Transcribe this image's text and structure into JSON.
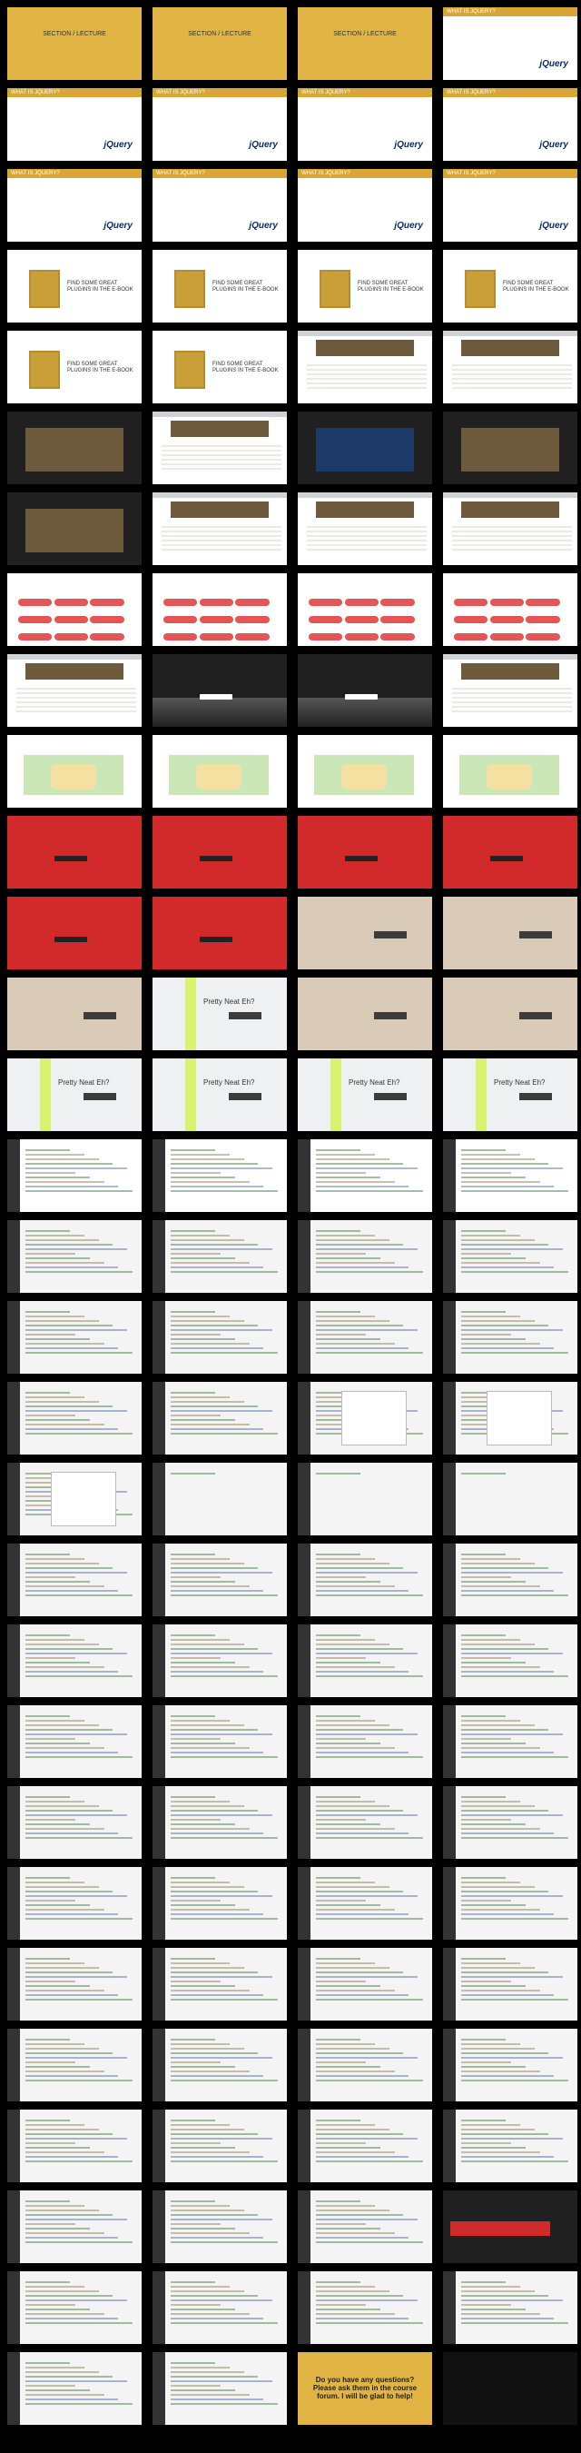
{
  "slide_texts": {
    "what_is_jquery": "WHAT IS JQUERY?",
    "section_label": "SECTION",
    "lecture_label": "LECTURE",
    "jquery_logo": "jQuery",
    "find_plugins": "FIND SOME GREAT PLUGINS IN THE E-BOOK",
    "pretty_neat": "Pretty Neat Eh?",
    "final_question": "Do you have any questions? Please ask them in the course forum. I will be glad to help!"
  },
  "rows": [
    {
      "cells": [
        {
          "type": "gold-section"
        },
        {
          "type": "gold-section"
        },
        {
          "type": "gold-section"
        },
        {
          "type": "white-header"
        }
      ]
    },
    {
      "cells": [
        {
          "type": "white-header"
        },
        {
          "type": "white-header"
        },
        {
          "type": "white-header"
        },
        {
          "type": "white-header"
        }
      ]
    },
    {
      "cells": [
        {
          "type": "white-header"
        },
        {
          "type": "white-header"
        },
        {
          "type": "white-header"
        },
        {
          "type": "white-header"
        }
      ]
    },
    {
      "cells": [
        {
          "type": "white-book"
        },
        {
          "type": "white-book"
        },
        {
          "type": "white-book"
        },
        {
          "type": "white-book"
        }
      ]
    },
    {
      "cells": [
        {
          "type": "white-book"
        },
        {
          "type": "white-book"
        },
        {
          "type": "browser-article"
        },
        {
          "type": "browser-article"
        }
      ]
    },
    {
      "cells": [
        {
          "type": "dark-image"
        },
        {
          "type": "browser-article"
        },
        {
          "type": "dark-image-blue"
        },
        {
          "type": "dark-image"
        }
      ]
    },
    {
      "cells": [
        {
          "type": "dark-image"
        },
        {
          "type": "browser-article"
        },
        {
          "type": "browser-article"
        },
        {
          "type": "browser-article"
        }
      ]
    },
    {
      "cells": [
        {
          "type": "tiles"
        },
        {
          "type": "tiles"
        },
        {
          "type": "tiles"
        },
        {
          "type": "tiles"
        }
      ]
    },
    {
      "cells": [
        {
          "type": "browser-article"
        },
        {
          "type": "mountains"
        },
        {
          "type": "mountains"
        },
        {
          "type": "browser-article"
        }
      ]
    },
    {
      "cells": [
        {
          "type": "map"
        },
        {
          "type": "map"
        },
        {
          "type": "map"
        },
        {
          "type": "map"
        }
      ]
    },
    {
      "cells": [
        {
          "type": "red"
        },
        {
          "type": "red"
        },
        {
          "type": "red"
        },
        {
          "type": "red"
        }
      ]
    },
    {
      "cells": [
        {
          "type": "red"
        },
        {
          "type": "red"
        },
        {
          "type": "beige"
        },
        {
          "type": "beige"
        }
      ]
    },
    {
      "cells": [
        {
          "type": "beige"
        },
        {
          "type": "yellow"
        },
        {
          "type": "beige"
        },
        {
          "type": "beige"
        }
      ]
    },
    {
      "cells": [
        {
          "type": "yellow"
        },
        {
          "type": "yellow"
        },
        {
          "type": "yellow"
        },
        {
          "type": "yellow"
        }
      ]
    },
    {
      "cells": [
        {
          "type": "code-doc"
        },
        {
          "type": "code-doc"
        },
        {
          "type": "code-doc"
        },
        {
          "type": "code-doc"
        }
      ]
    },
    {
      "cells": [
        {
          "type": "code"
        },
        {
          "type": "code"
        },
        {
          "type": "code"
        },
        {
          "type": "code"
        }
      ]
    },
    {
      "cells": [
        {
          "type": "code"
        },
        {
          "type": "code"
        },
        {
          "type": "code"
        },
        {
          "type": "code"
        }
      ]
    },
    {
      "cells": [
        {
          "type": "code"
        },
        {
          "type": "code"
        },
        {
          "type": "code-modal"
        },
        {
          "type": "code-modal"
        }
      ]
    },
    {
      "cells": [
        {
          "type": "code-modal"
        },
        {
          "type": "code-blank"
        },
        {
          "type": "code-blank"
        },
        {
          "type": "code-blank"
        }
      ]
    },
    {
      "cells": [
        {
          "type": "code"
        },
        {
          "type": "code"
        },
        {
          "type": "code"
        },
        {
          "type": "code"
        }
      ]
    },
    {
      "cells": [
        {
          "type": "code"
        },
        {
          "type": "code"
        },
        {
          "type": "code"
        },
        {
          "type": "code"
        }
      ]
    },
    {
      "cells": [
        {
          "type": "code"
        },
        {
          "type": "code"
        },
        {
          "type": "code"
        },
        {
          "type": "code"
        }
      ]
    },
    {
      "cells": [
        {
          "type": "code"
        },
        {
          "type": "code"
        },
        {
          "type": "code"
        },
        {
          "type": "code"
        }
      ]
    },
    {
      "cells": [
        {
          "type": "code"
        },
        {
          "type": "code"
        },
        {
          "type": "code"
        },
        {
          "type": "code"
        }
      ]
    },
    {
      "cells": [
        {
          "type": "code"
        },
        {
          "type": "code"
        },
        {
          "type": "code"
        },
        {
          "type": "code"
        }
      ]
    },
    {
      "cells": [
        {
          "type": "code"
        },
        {
          "type": "code"
        },
        {
          "type": "code"
        },
        {
          "type": "code"
        }
      ]
    },
    {
      "cells": [
        {
          "type": "code"
        },
        {
          "type": "code"
        },
        {
          "type": "code"
        },
        {
          "type": "code"
        }
      ]
    },
    {
      "cells": [
        {
          "type": "code"
        },
        {
          "type": "code"
        },
        {
          "type": "code"
        },
        {
          "type": "dark-red-panel"
        }
      ]
    },
    {
      "cells": [
        {
          "type": "code"
        },
        {
          "type": "code"
        },
        {
          "type": "code"
        },
        {
          "type": "code"
        }
      ]
    },
    {
      "cells": [
        {
          "type": "code"
        },
        {
          "type": "code"
        },
        {
          "type": "gold-final"
        },
        {
          "type": "black"
        }
      ]
    }
  ]
}
